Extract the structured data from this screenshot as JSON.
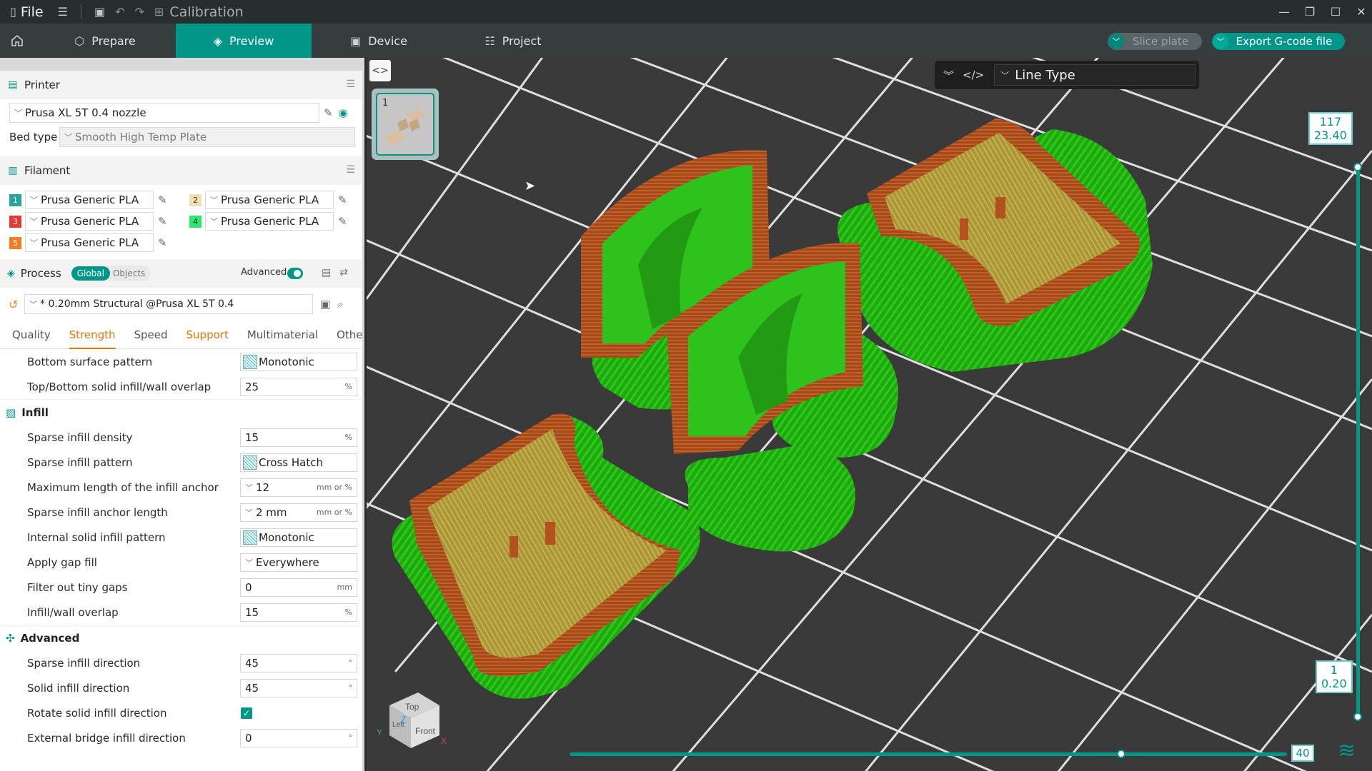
{
  "titlebar": {
    "file_label": "File",
    "project_title": "Calibration",
    "window_controls": [
      "minimize",
      "restore",
      "maximize",
      "close"
    ]
  },
  "tabs": [
    {
      "label": "Prepare",
      "icon": "cube-icon"
    },
    {
      "label": "Preview",
      "icon": "layers-icon",
      "active": true
    },
    {
      "label": "Device",
      "icon": "device-icon"
    },
    {
      "label": "Project",
      "icon": "project-icon"
    }
  ],
  "actions": {
    "slice_label": "Slice plate",
    "export_label": "Export G-code file"
  },
  "printer": {
    "header": "Printer",
    "name": "Prusa XL 5T 0.4 nozzle",
    "bed_type_label": "Bed type",
    "bed_type_value": "Smooth High Temp Plate"
  },
  "filament": {
    "header": "Filament",
    "items": [
      {
        "num": "1",
        "name": "Prusa Generic PLA",
        "color": "#26a69a"
      },
      {
        "num": "2",
        "name": "Prusa Generic PLA",
        "color": "#f5deb3"
      },
      {
        "num": "3",
        "name": "Prusa Generic PLA",
        "color": "#e53935"
      },
      {
        "num": "4",
        "name": "Prusa Generic PLA",
        "color": "#2ee86a"
      },
      {
        "num": "5",
        "name": "Prusa Generic PLA",
        "color": "#f57c1f"
      }
    ]
  },
  "process": {
    "header": "Process",
    "global_label": "Global",
    "objects_label": "Objects",
    "advanced_label": "Advanced",
    "advanced_on": true,
    "preset": "* 0.20mm Structural @Prusa XL 5T 0.4"
  },
  "subtabs": [
    {
      "label": "Quality"
    },
    {
      "label": "Strength",
      "active": true
    },
    {
      "label": "Speed"
    },
    {
      "label": "Support",
      "warn": true
    },
    {
      "label": "Multimaterial"
    },
    {
      "label": "Others"
    }
  ],
  "options_top": [
    {
      "label": "Bottom surface pattern",
      "value": "Monotonic",
      "pattern": true
    },
    {
      "label": "Top/Bottom solid infill/wall overlap",
      "value": "25",
      "unit": "%"
    }
  ],
  "infill": {
    "header": "Infill",
    "options": [
      {
        "label": "Sparse infill density",
        "value": "15",
        "unit": "%"
      },
      {
        "label": "Sparse infill pattern",
        "value": "Cross Hatch",
        "pattern": true
      },
      {
        "label": "Maximum length of the infill anchor",
        "value": "12",
        "unit": "mm or %",
        "combo": true
      },
      {
        "label": "Sparse infill anchor length",
        "value": "2 mm",
        "unit": "mm or %",
        "combo": true
      },
      {
        "label": "Internal solid infill pattern",
        "value": "Monotonic",
        "pattern": true
      },
      {
        "label": "Apply gap fill",
        "value": "Everywhere",
        "combo": true
      },
      {
        "label": "Filter out tiny gaps",
        "value": "0",
        "unit": "mm"
      },
      {
        "label": "Infill/wall overlap",
        "value": "15",
        "unit": "%"
      }
    ]
  },
  "advanced": {
    "header": "Advanced",
    "options": [
      {
        "label": "Sparse infill direction",
        "value": "45",
        "unit": "°"
      },
      {
        "label": "Solid infill direction",
        "value": "45",
        "unit": "°"
      },
      {
        "label": "Rotate solid infill direction",
        "checkbox": true
      },
      {
        "label": "External bridge infill direction",
        "value": "0",
        "unit": "°"
      }
    ]
  },
  "viewport": {
    "plate_number": "1",
    "line_type_label": "Line Type",
    "layer_top": "117",
    "height_top": "23.40",
    "layer_bottom": "1",
    "height_bottom": "0.20",
    "move_value": "40",
    "navcube": {
      "top": "Top",
      "front": "Front",
      "left": "Left",
      "x": "X",
      "y": "Y",
      "z": "Z"
    }
  },
  "colors": {
    "accent": "#009688",
    "support_green": "#22b811",
    "wall_brown": "#b0521e",
    "infill_yellow": "#b8a23e",
    "warn_orange": "#e8750a"
  }
}
